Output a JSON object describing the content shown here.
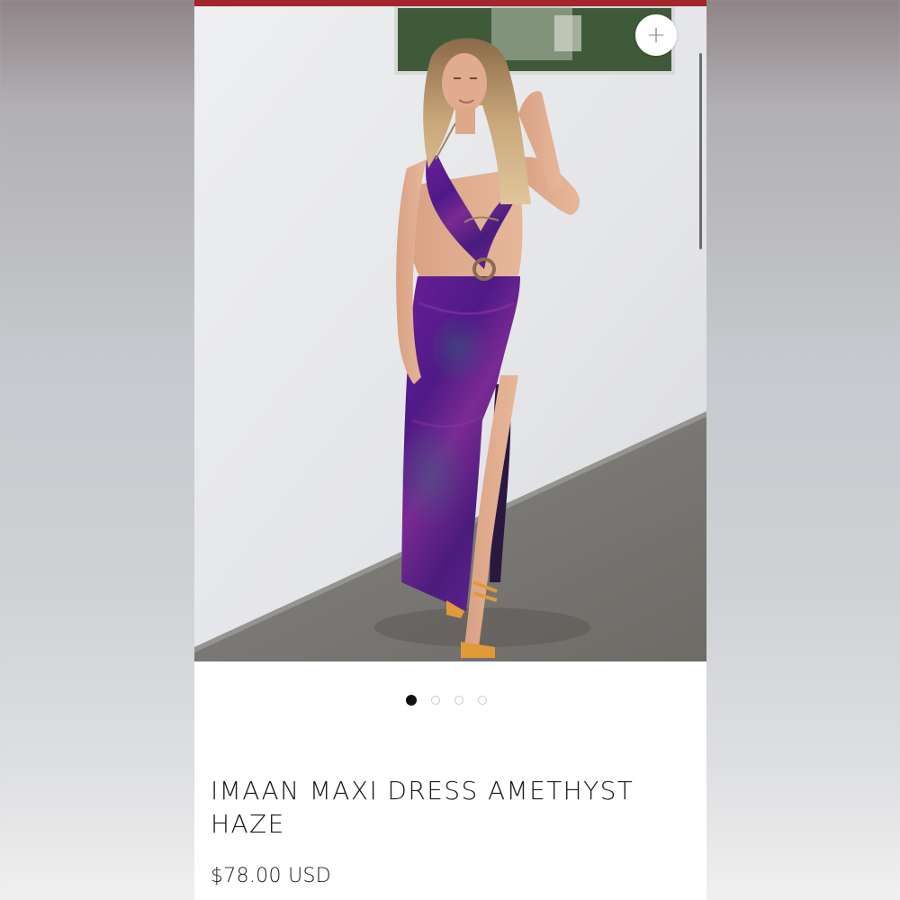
{
  "product": {
    "title": "IMAAN MAXI DRESS AMETHYST HAZE",
    "price": "$78.00 USD",
    "image_alt": "Model wearing purple tie-dye cut-out maxi dress with thigh-high slit and orange strappy heels"
  },
  "gallery": {
    "zoom_icon": "plus-icon",
    "slides": [
      {
        "active": true
      },
      {
        "active": false
      },
      {
        "active": false
      },
      {
        "active": false
      }
    ]
  },
  "colors": {
    "brand_bar": "#a2262b",
    "dress": "#5e1f8f",
    "active_dot": "#111111"
  }
}
